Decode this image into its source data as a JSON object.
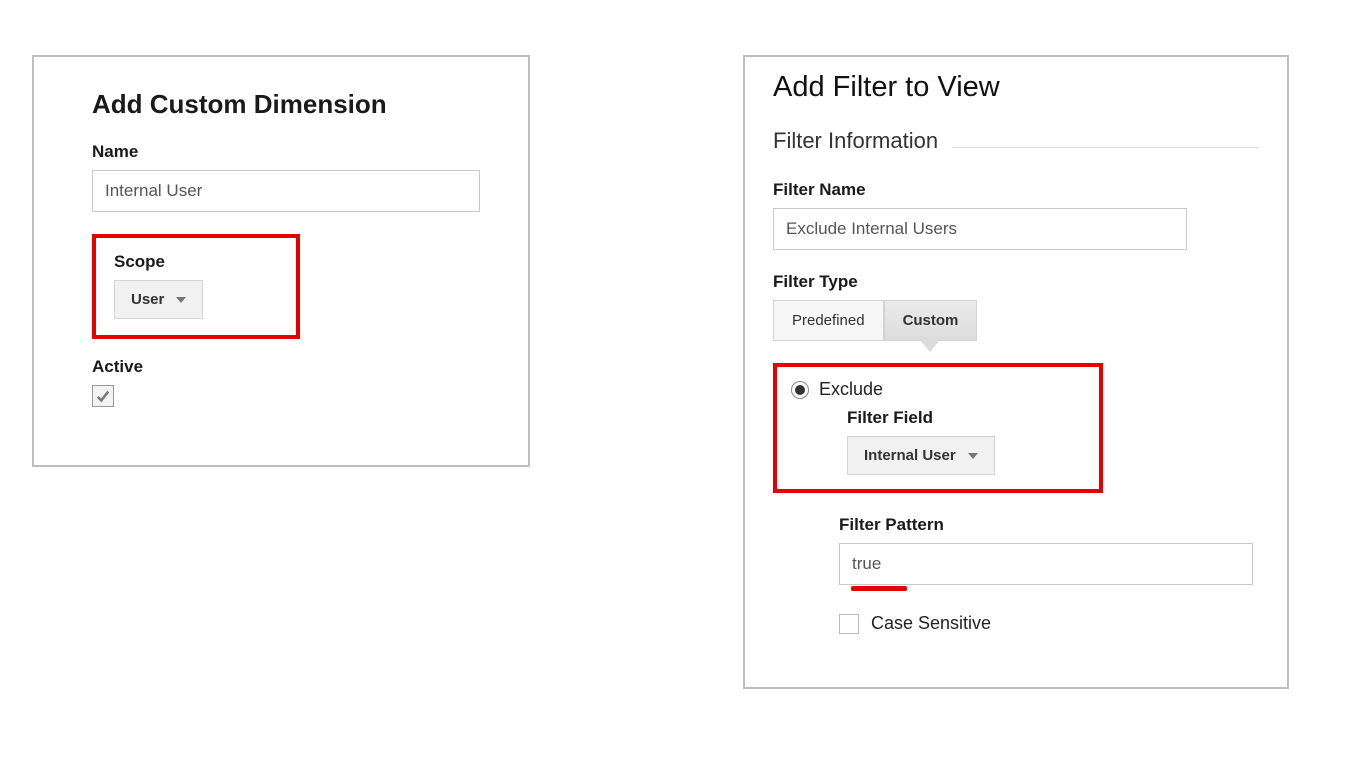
{
  "left_panel": {
    "title": "Add Custom Dimension",
    "name_label": "Name",
    "name_value": "Internal User",
    "scope_label": "Scope",
    "scope_value": "User",
    "active_label": "Active",
    "active_checked": true
  },
  "right_panel": {
    "title": "Add Filter to View",
    "section": "Filter Information",
    "filter_name_label": "Filter Name",
    "filter_name_value": "Exclude Internal Users",
    "filter_type_label": "Filter Type",
    "tabs": {
      "predefined": "Predefined",
      "custom": "Custom"
    },
    "exclude_label": "Exclude",
    "filter_field_label": "Filter Field",
    "filter_field_value": "Internal User",
    "filter_pattern_label": "Filter Pattern",
    "filter_pattern_value": "true",
    "case_sensitive_label": "Case Sensitive"
  }
}
